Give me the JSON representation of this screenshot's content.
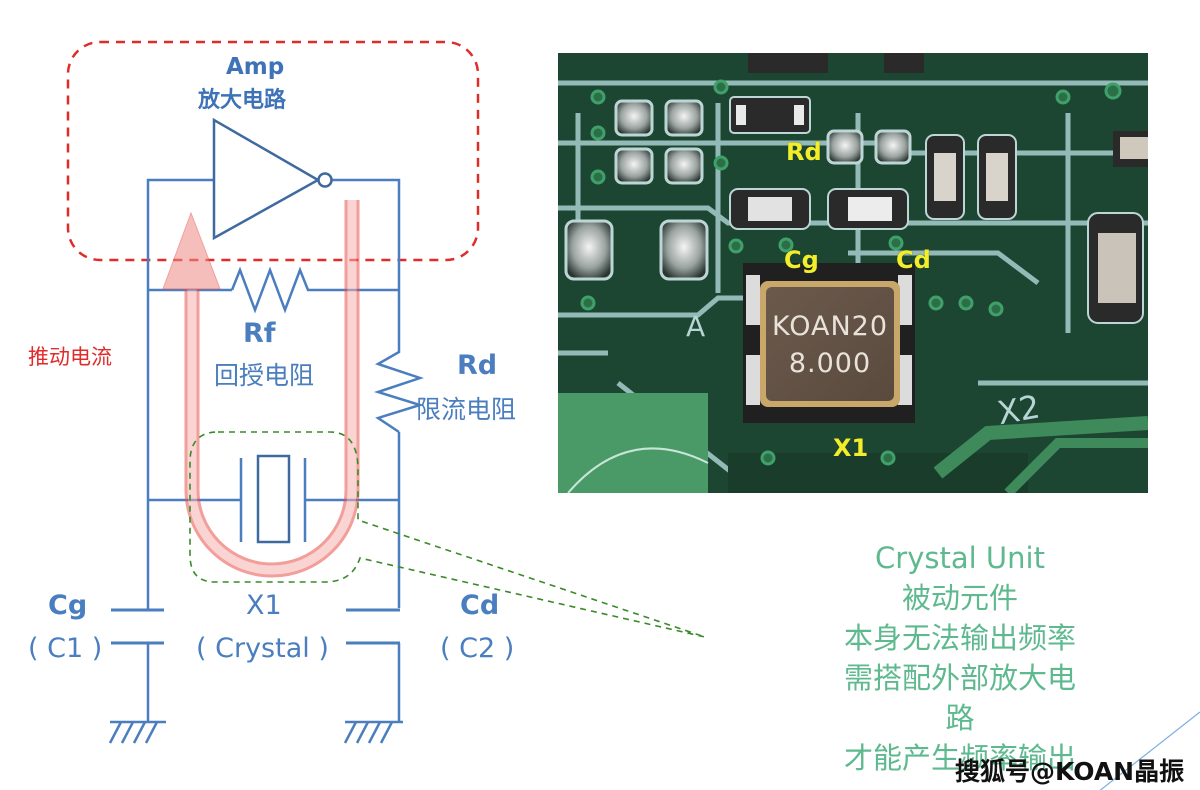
{
  "schematic": {
    "amp_label_en": "Amp",
    "amp_label_zh": "放大电路",
    "drive_current_label": "推动电流",
    "rf_label_en": "Rf",
    "rf_label_zh": "回授电阻",
    "rd_label_en": "Rd",
    "rd_label_zh": "限流电阻",
    "cg_label": "Cg",
    "cg_sub": "( C1 )",
    "x1_label": "X1",
    "x1_sub": "( Crystal )",
    "cd_label": "Cd",
    "cd_sub": "( C2 )",
    "colors": {
      "wire": "#4a7ebf",
      "amp_box": "#e02b2b",
      "current_path": "#f08a85",
      "callout": "#3a8a2a"
    }
  },
  "photo": {
    "chip_line1": "KOAN20",
    "chip_line2": "8.000",
    "labels": {
      "rd": "Rd",
      "cg": "Cg",
      "cd": "Cd",
      "x1": "X1"
    },
    "silkscreen": {
      "a": "A",
      "x2": "X2"
    }
  },
  "callout": {
    "title": "Crystal Unit",
    "lines": [
      "被动元件",
      "本身无法输出频率",
      "需搭配外部放大电路",
      "才能产生频率输出"
    ]
  },
  "watermark": "搜狐号@KOAN晶振"
}
